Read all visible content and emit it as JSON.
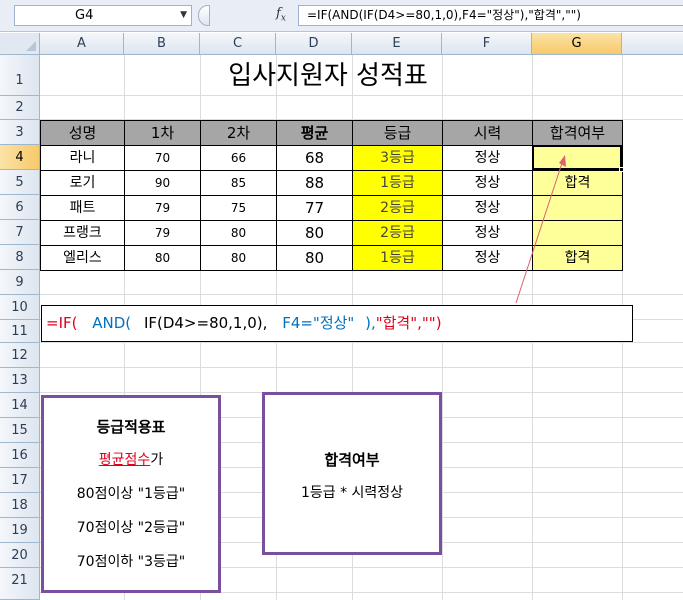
{
  "formula_bar": {
    "name_box": "G4",
    "fx_label": "f",
    "fx_sub": "x",
    "formula": "=IF(AND(IF(D4>=80,1,0),F4=\"정상\"),\"합격\",\"\")"
  },
  "columns": [
    "A",
    "B",
    "C",
    "D",
    "E",
    "F",
    "G"
  ],
  "rows": [
    "1",
    "2",
    "3",
    "4",
    "5",
    "6",
    "7",
    "8",
    "9",
    "10",
    "11",
    "12",
    "13",
    "14",
    "15",
    "16",
    "17",
    "18",
    "19",
    "20",
    "21"
  ],
  "title": "입사지원자 성적표",
  "table": {
    "headers": [
      "성명",
      "1차",
      "2차",
      "평균",
      "등급",
      "시력",
      "합격여부"
    ],
    "rows": [
      {
        "name": "라니",
        "first": "70",
        "second": "66",
        "avg": "68",
        "grade": "3등급",
        "vision": "정상",
        "pass": ""
      },
      {
        "name": "로기",
        "first": "90",
        "second": "85",
        "avg": "88",
        "grade": "1등급",
        "vision": "정상",
        "pass": "합격"
      },
      {
        "name": "패트",
        "first": "79",
        "second": "75",
        "avg": "77",
        "grade": "2등급",
        "vision": "정상",
        "pass": ""
      },
      {
        "name": "프랭크",
        "first": "79",
        "second": "80",
        "avg": "80",
        "grade": "2등급",
        "vision": "정상",
        "pass": ""
      },
      {
        "name": "엘리스",
        "first": "80",
        "second": "80",
        "avg": "80",
        "grade": "1등급",
        "vision": "정상",
        "pass": "합격"
      }
    ]
  },
  "formula_box": {
    "p1": "=IF(",
    "p2": "AND(",
    "p3": "IF(D4>=80,1,0),",
    "p4": "F4=\"정상\"",
    "p5": "),",
    "p6": "\"합격\",\"\")"
  },
  "grade_box": {
    "title": "등급적용표",
    "subtitle_red": "평균점수",
    "subtitle_tail": "가",
    "line1": "80점이상 \"1등급\"",
    "line2": "70점이상 \"2등급\"",
    "line3": "70점이하 \"3등급\""
  },
  "pass_box": {
    "title": "합격여부",
    "line1": "1등급 * 시력정상"
  },
  "colors": {
    "header_gray": "#a6a6a6",
    "grade_yellow": "#ffff00",
    "pass_light_yellow": "#ffff99",
    "box_purple": "#7b4fa0",
    "formula_red": "#e0001b",
    "formula_blue": "#0070c0"
  }
}
